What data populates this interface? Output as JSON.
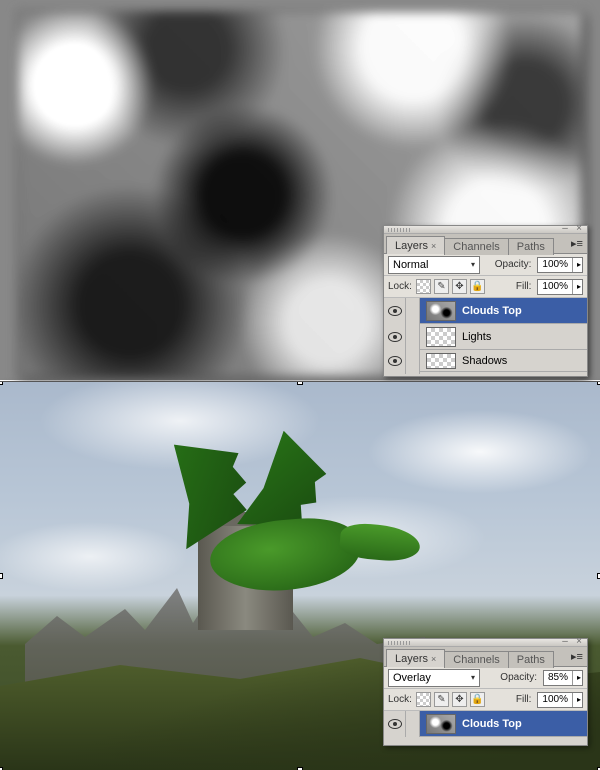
{
  "tabs": {
    "layers": "Layers",
    "channels": "Channels",
    "paths": "Paths"
  },
  "labels": {
    "opacity": "Opacity:",
    "fill": "Fill:",
    "lock": "Lock:"
  },
  "panel_top": {
    "blend_mode": "Normal",
    "opacity_value": "100%",
    "fill_value": "100%",
    "layers": [
      {
        "name": "Clouds Top",
        "thumb": "clouds",
        "selected": true,
        "visible": true
      },
      {
        "name": "Lights",
        "thumb": "trans",
        "selected": false,
        "visible": true
      },
      {
        "name": "Shadows",
        "thumb": "trans",
        "selected": false,
        "visible": true
      }
    ]
  },
  "panel_bottom": {
    "blend_mode": "Overlay",
    "opacity_value": "85%",
    "fill_value": "100%",
    "layers": [
      {
        "name": "Clouds Top",
        "thumb": "clouds",
        "selected": true,
        "visible": true
      }
    ]
  },
  "icons": {
    "minimize": "–",
    "close": "×",
    "menu": "▸≡",
    "dropdown": "▾",
    "popout": "▸",
    "brush": "✎",
    "move": "✥",
    "lock": "🔒"
  }
}
